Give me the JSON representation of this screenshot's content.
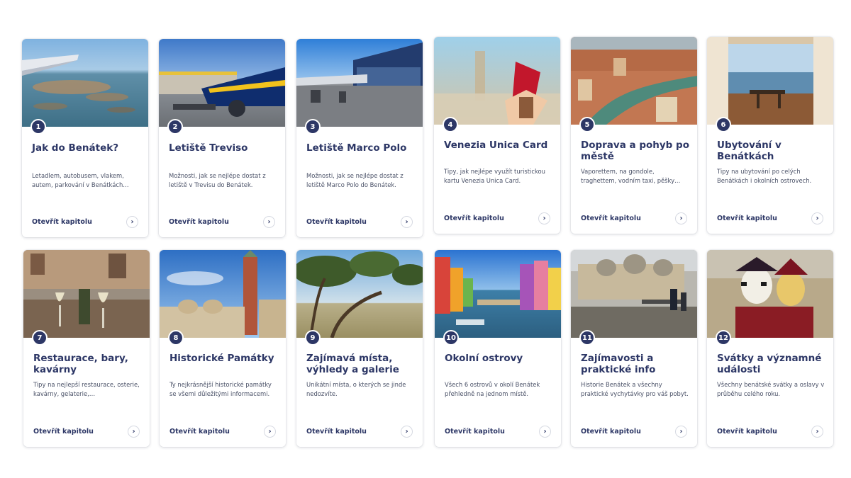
{
  "cards": [
    {
      "number": "1",
      "title": "Jak do Benátek?",
      "description": "Letadlem, autobusem, vlakem, autem, parkování v Benátkách…",
      "link": "Otevřít kapitolu",
      "arrow": "›",
      "image": "airplane-wing-venice-aerial"
    },
    {
      "number": "2",
      "title": "Letiště Treviso",
      "description": "Možnosti, jak se nejlépe dostat z letiště v Trevisu do Benátek.",
      "link": "Otevřít kapitolu",
      "arrow": "›",
      "image": "ryanair-plane-treviso"
    },
    {
      "number": "3",
      "title": "Letiště Marco Polo",
      "description": "Možnosti, jak se nejlépe dostat z letiště Marco Polo do Benátek.",
      "link": "Otevřít kapitolu",
      "arrow": "›",
      "image": "marco-polo-airport"
    },
    {
      "number": "4",
      "title": "Venezia Unica Card",
      "description": "Tipy, jak nejlépe využít turistickou kartu Venezia Unica Card.",
      "link": "Otevřít kapitolu",
      "arrow": "›",
      "image": "hand-with-card"
    },
    {
      "number": "5",
      "title": "Doprava a pohyb po městě",
      "description": "Vaporettem, na gondole, traghettem, vodním taxi, pěšky…",
      "link": "Otevřít kapitolu",
      "arrow": "›",
      "image": "grand-canal-aerial"
    },
    {
      "number": "6",
      "title": "Ubytování v Benátkách",
      "description": "Tipy na ubytování po celých Benátkách i okolních ostrovech.",
      "link": "Otevřít kapitolu",
      "arrow": "›",
      "image": "hotel-room-interior"
    },
    {
      "number": "7",
      "title": "Restaurace, bary, kavárny",
      "description": "Tipy na nejlepší restaurace, osterie, kavárny, gelaterie,…",
      "link": "Otevřít kapitolu",
      "arrow": "›",
      "image": "wine-glasses-canal"
    },
    {
      "number": "8",
      "title": "Historické Památky",
      "description": "Ty nejkrásnější historické památky se všemi důležitými informacemi.",
      "link": "Otevřít kapitolu",
      "arrow": "›",
      "image": "campanile-st-mark"
    },
    {
      "number": "9",
      "title": "Zajímavá místa, výhledy a galerie",
      "description": "Unikátní místa, o kterých se jinde nedozvíte.",
      "link": "Otevřít kapitolu",
      "arrow": "›",
      "image": "pine-trees-lagoon"
    },
    {
      "number": "10",
      "title": "Okolní ostrovy",
      "description": "Všech 6 ostrovů v okolí Benátek přehledně na jednom místě.",
      "link": "Otevřít kapitolu",
      "arrow": "›",
      "image": "burano-colorful-houses"
    },
    {
      "number": "11",
      "title": "Zajímavosti a praktické info",
      "description": "Historie Benátek a všechny praktické vychytávky pro váš pobyt.",
      "link": "Otevřít kapitolu",
      "arrow": "›",
      "image": "acqua-alta-st-mark"
    },
    {
      "number": "12",
      "title": "Svátky a významné události",
      "description": "Všechny benátské svátky a oslavy v průběhu celého roku.",
      "link": "Otevřít kapitolu",
      "arrow": "›",
      "image": "carnival-masks"
    }
  ]
}
